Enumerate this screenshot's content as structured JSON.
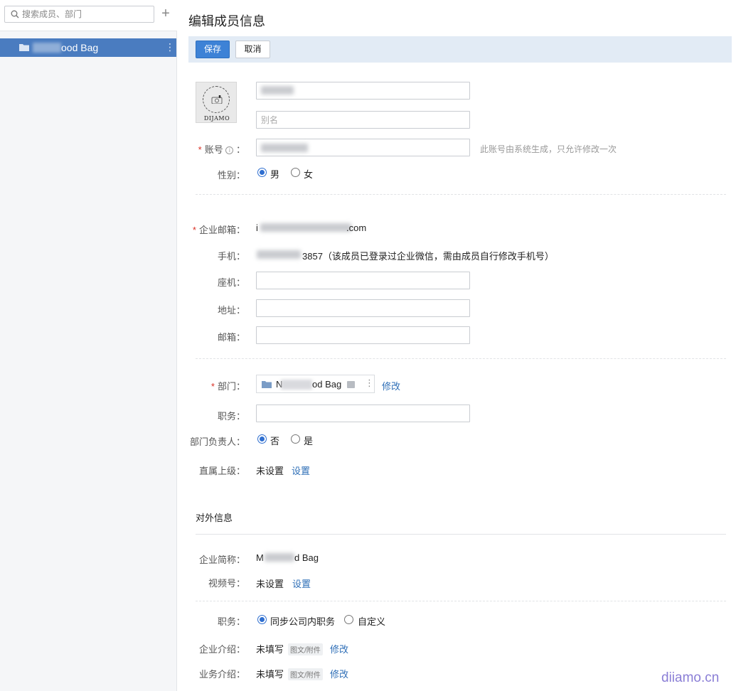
{
  "sidebar": {
    "search_placeholder": "搜索成员、部门",
    "add_icon": "plus-icon",
    "departments": [
      {
        "label": "ood Bag",
        "icon": "folder-icon"
      }
    ]
  },
  "page": {
    "title": "编辑成员信息"
  },
  "toolbar": {
    "save_label": "保存",
    "cancel_label": "取消"
  },
  "avatar": {
    "brand_text": "DIJAMO"
  },
  "basic": {
    "name_value": "",
    "alias_placeholder": "别名",
    "account_label": "账号",
    "account_hint": "此账号由系统生成，只允许修改一次",
    "gender_label": "性别：",
    "gender_options": [
      "男",
      "女"
    ],
    "gender_selected": "男"
  },
  "contact": {
    "email_label": "企业邮箱：",
    "email_value": ".com",
    "email_prefix": "i",
    "phone_label": "手机：",
    "phone_value": "3857（该成员已登录过企业微信，需由成员自行修改手机号）",
    "landline_label": "座机：",
    "address_label": "地址：",
    "mailbox_label": "邮箱："
  },
  "org": {
    "dept_label": "部门：",
    "dept_name": "N",
    "dept_suffix": "od Bag",
    "dept_modify": "修改",
    "title_label": "职务：",
    "leader_label": "部门负责人：",
    "leader_options": [
      "否",
      "是"
    ],
    "leader_selected": "否",
    "superior_label": "直属上级：",
    "superior_value": "未设置",
    "superior_action": "设置"
  },
  "external": {
    "section_title": "对外信息",
    "company_label": "企业简称：",
    "company_value": "M",
    "company_suffix": "d Bag",
    "channel_label": "视频号：",
    "channel_value": "未设置",
    "channel_action": "设置",
    "position_label": "职务：",
    "position_options": [
      "同步公司内职务",
      "自定义"
    ],
    "position_selected": "同步公司内职务",
    "intro_label": "企业介绍：",
    "intro_value": "未填写",
    "intro_badge": "图文/附件",
    "intro_action": "修改",
    "business_label": "业务介绍：",
    "business_value": "未填写",
    "business_badge": "图文/附件",
    "business_action": "修改"
  },
  "watermark": "diiamo.cn",
  "colors": {
    "primary": "#3d82d6",
    "sidebar_selected": "#4a7cc0",
    "toolbar_bg": "#e2ebf5",
    "link": "#2f6fb7",
    "required": "#d93025"
  }
}
